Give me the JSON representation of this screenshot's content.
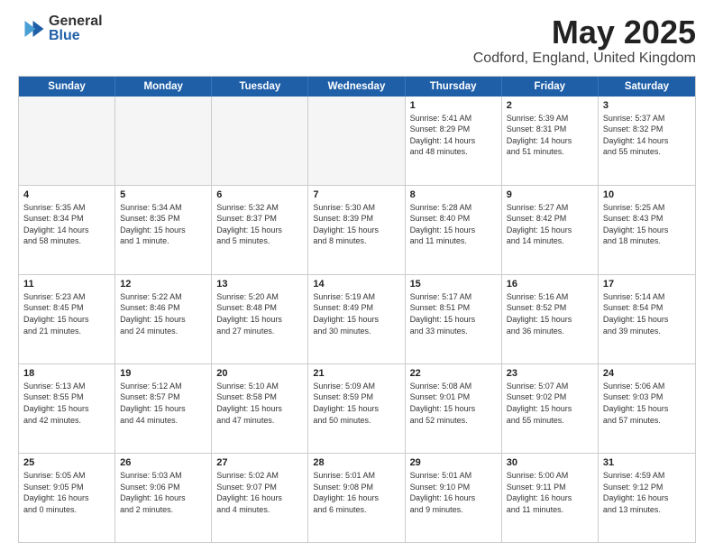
{
  "logo": {
    "general": "General",
    "blue": "Blue",
    "icon": "▶"
  },
  "title": {
    "month": "May 2025",
    "location": "Codford, England, United Kingdom"
  },
  "header": {
    "days": [
      "Sunday",
      "Monday",
      "Tuesday",
      "Wednesday",
      "Thursday",
      "Friday",
      "Saturday"
    ]
  },
  "weeks": [
    [
      {
        "day": "",
        "info": "",
        "empty": true
      },
      {
        "day": "",
        "info": "",
        "empty": true
      },
      {
        "day": "",
        "info": "",
        "empty": true
      },
      {
        "day": "",
        "info": "",
        "empty": true
      },
      {
        "day": "1",
        "info": "Sunrise: 5:41 AM\nSunset: 8:29 PM\nDaylight: 14 hours\nand 48 minutes.",
        "empty": false
      },
      {
        "day": "2",
        "info": "Sunrise: 5:39 AM\nSunset: 8:31 PM\nDaylight: 14 hours\nand 51 minutes.",
        "empty": false
      },
      {
        "day": "3",
        "info": "Sunrise: 5:37 AM\nSunset: 8:32 PM\nDaylight: 14 hours\nand 55 minutes.",
        "empty": false
      }
    ],
    [
      {
        "day": "4",
        "info": "Sunrise: 5:35 AM\nSunset: 8:34 PM\nDaylight: 14 hours\nand 58 minutes.",
        "empty": false
      },
      {
        "day": "5",
        "info": "Sunrise: 5:34 AM\nSunset: 8:35 PM\nDaylight: 15 hours\nand 1 minute.",
        "empty": false
      },
      {
        "day": "6",
        "info": "Sunrise: 5:32 AM\nSunset: 8:37 PM\nDaylight: 15 hours\nand 5 minutes.",
        "empty": false
      },
      {
        "day": "7",
        "info": "Sunrise: 5:30 AM\nSunset: 8:39 PM\nDaylight: 15 hours\nand 8 minutes.",
        "empty": false
      },
      {
        "day": "8",
        "info": "Sunrise: 5:28 AM\nSunset: 8:40 PM\nDaylight: 15 hours\nand 11 minutes.",
        "empty": false
      },
      {
        "day": "9",
        "info": "Sunrise: 5:27 AM\nSunset: 8:42 PM\nDaylight: 15 hours\nand 14 minutes.",
        "empty": false
      },
      {
        "day": "10",
        "info": "Sunrise: 5:25 AM\nSunset: 8:43 PM\nDaylight: 15 hours\nand 18 minutes.",
        "empty": false
      }
    ],
    [
      {
        "day": "11",
        "info": "Sunrise: 5:23 AM\nSunset: 8:45 PM\nDaylight: 15 hours\nand 21 minutes.",
        "empty": false
      },
      {
        "day": "12",
        "info": "Sunrise: 5:22 AM\nSunset: 8:46 PM\nDaylight: 15 hours\nand 24 minutes.",
        "empty": false
      },
      {
        "day": "13",
        "info": "Sunrise: 5:20 AM\nSunset: 8:48 PM\nDaylight: 15 hours\nand 27 minutes.",
        "empty": false
      },
      {
        "day": "14",
        "info": "Sunrise: 5:19 AM\nSunset: 8:49 PM\nDaylight: 15 hours\nand 30 minutes.",
        "empty": false
      },
      {
        "day": "15",
        "info": "Sunrise: 5:17 AM\nSunset: 8:51 PM\nDaylight: 15 hours\nand 33 minutes.",
        "empty": false
      },
      {
        "day": "16",
        "info": "Sunrise: 5:16 AM\nSunset: 8:52 PM\nDaylight: 15 hours\nand 36 minutes.",
        "empty": false
      },
      {
        "day": "17",
        "info": "Sunrise: 5:14 AM\nSunset: 8:54 PM\nDaylight: 15 hours\nand 39 minutes.",
        "empty": false
      }
    ],
    [
      {
        "day": "18",
        "info": "Sunrise: 5:13 AM\nSunset: 8:55 PM\nDaylight: 15 hours\nand 42 minutes.",
        "empty": false
      },
      {
        "day": "19",
        "info": "Sunrise: 5:12 AM\nSunset: 8:57 PM\nDaylight: 15 hours\nand 44 minutes.",
        "empty": false
      },
      {
        "day": "20",
        "info": "Sunrise: 5:10 AM\nSunset: 8:58 PM\nDaylight: 15 hours\nand 47 minutes.",
        "empty": false
      },
      {
        "day": "21",
        "info": "Sunrise: 5:09 AM\nSunset: 8:59 PM\nDaylight: 15 hours\nand 50 minutes.",
        "empty": false
      },
      {
        "day": "22",
        "info": "Sunrise: 5:08 AM\nSunset: 9:01 PM\nDaylight: 15 hours\nand 52 minutes.",
        "empty": false
      },
      {
        "day": "23",
        "info": "Sunrise: 5:07 AM\nSunset: 9:02 PM\nDaylight: 15 hours\nand 55 minutes.",
        "empty": false
      },
      {
        "day": "24",
        "info": "Sunrise: 5:06 AM\nSunset: 9:03 PM\nDaylight: 15 hours\nand 57 minutes.",
        "empty": false
      }
    ],
    [
      {
        "day": "25",
        "info": "Sunrise: 5:05 AM\nSunset: 9:05 PM\nDaylight: 16 hours\nand 0 minutes.",
        "empty": false
      },
      {
        "day": "26",
        "info": "Sunrise: 5:03 AM\nSunset: 9:06 PM\nDaylight: 16 hours\nand 2 minutes.",
        "empty": false
      },
      {
        "day": "27",
        "info": "Sunrise: 5:02 AM\nSunset: 9:07 PM\nDaylight: 16 hours\nand 4 minutes.",
        "empty": false
      },
      {
        "day": "28",
        "info": "Sunrise: 5:01 AM\nSunset: 9:08 PM\nDaylight: 16 hours\nand 6 minutes.",
        "empty": false
      },
      {
        "day": "29",
        "info": "Sunrise: 5:01 AM\nSunset: 9:10 PM\nDaylight: 16 hours\nand 9 minutes.",
        "empty": false
      },
      {
        "day": "30",
        "info": "Sunrise: 5:00 AM\nSunset: 9:11 PM\nDaylight: 16 hours\nand 11 minutes.",
        "empty": false
      },
      {
        "day": "31",
        "info": "Sunrise: 4:59 AM\nSunset: 9:12 PM\nDaylight: 16 hours\nand 13 minutes.",
        "empty": false
      }
    ]
  ]
}
